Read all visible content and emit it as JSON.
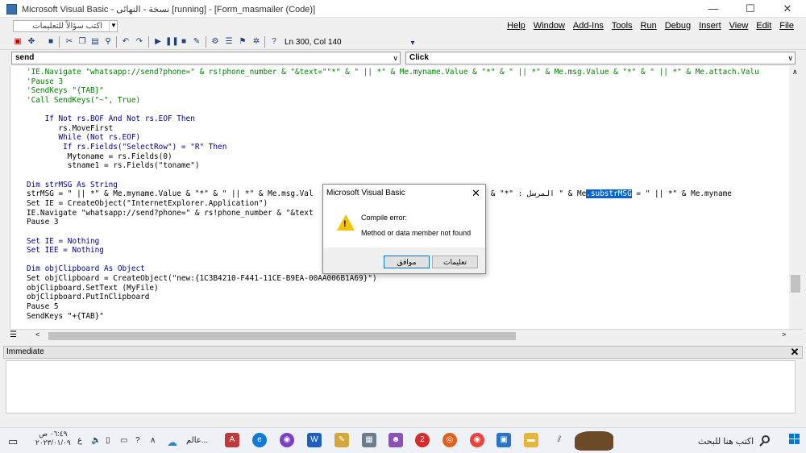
{
  "window": {
    "title": "Microsoft Visual Basic - نسخة - النهائى [running] - [Form_masmailer (Code)]",
    "minimize": "—",
    "maximize": "☐",
    "close": "✕"
  },
  "help_box": {
    "placeholder": "اكتب سؤالاً للتعليمات"
  },
  "menu": [
    "Help",
    "Window",
    "Add-Ins",
    "Tools",
    "Run",
    "Debug",
    "Insert",
    "View",
    "Edit",
    "File"
  ],
  "toolbar": {
    "status": "Ln 300, Col 140"
  },
  "combos": {
    "object": "send",
    "procedure": "Click"
  },
  "code_lines": [
    {
      "cls": "cm",
      "text": "'IE.Navigate \"whatsapp://send?phone=\" & rs!phone_number & \"&text=\"\"*\" & \" || *\" & Me.myname.Value & \"*\" & \" || *\" & Me.msg.Value & \"*\" & \" || *\" & Me.attach.Valu"
    },
    {
      "cls": "cm",
      "text": "'Pause 3"
    },
    {
      "cls": "cm",
      "text": "'SendKeys \"{TAB}\""
    },
    {
      "cls": "cm",
      "text": "'Call SendKeys(\"~\", True)"
    },
    {
      "cls": "",
      "text": ""
    },
    {
      "cls": "kw",
      "text": "    If Not rs.BOF And Not rs.EOF Then"
    },
    {
      "cls": "",
      "text": "       rs.MoveFirst"
    },
    {
      "cls": "kw",
      "text": "       While (Not rs.EOF)"
    },
    {
      "cls": "kw",
      "text": "        If rs.Fields(\"SelectRow\") = \"R\" Then"
    },
    {
      "cls": "",
      "text": "         Mytoname = rs.Fields(0)"
    },
    {
      "cls": "",
      "text": "         stname1 = rs.Fields(\"toname\")"
    },
    {
      "cls": "",
      "text": ""
    },
    {
      "cls": "kw",
      "text": "Dim strMSG As String"
    },
    {
      "cls": "hlline",
      "pre": "strMSG = \" || *\" & Me.myname.Value & \"*\" & \" || *\" & Me.msg.Val                          e & \"*\" || \" & \"*\" : المرسل \" & Me",
      "hl": ".substrMSG",
      "post": " = \" || *\" & Me.myname"
    },
    {
      "cls": "",
      "text": "Set IE = CreateObject(\"InternetExplorer.Application\")"
    },
    {
      "cls": "",
      "text": "IE.Navigate \"whatsapp://send?phone=\" & rs!phone_number & \"&text                         t =0\""
    },
    {
      "cls": "",
      "text": "Pause 3"
    },
    {
      "cls": "",
      "text": ""
    },
    {
      "cls": "kw",
      "text": "Set IE = Nothing"
    },
    {
      "cls": "kw",
      "text": "Set IEE = Nothing"
    },
    {
      "cls": "",
      "text": ""
    },
    {
      "cls": "kw",
      "text": "Dim objClipboard As Object"
    },
    {
      "cls": "",
      "text": "Set objClipboard = CreateObject(\"new:{1C3B4210-F441-11CE-B9EA-00AA006B1A69}\")"
    },
    {
      "cls": "",
      "text": "objClipboard.SetText (MyFile)"
    },
    {
      "cls": "",
      "text": "objClipboard.PutInClipboard"
    },
    {
      "cls": "",
      "text": "Pause 5"
    },
    {
      "cls": "",
      "text": "SendKeys \"+{TAB}\""
    }
  ],
  "immediate": {
    "title": "Immediate",
    "close": "✕"
  },
  "dialog": {
    "title": "Microsoft Visual Basic",
    "close": "✕",
    "heading": "Compile error:",
    "message": "Method or data member not found",
    "ok_label": "موافق",
    "help_label": "تعليمات"
  },
  "taskbar": {
    "search_placeholder": "اكتب هنا للبحث",
    "weather": "عالم...",
    "lang": "ع",
    "time": "٠٦:٤٩ ص",
    "date": "٢٠٢٣/٠١/٠٩"
  }
}
